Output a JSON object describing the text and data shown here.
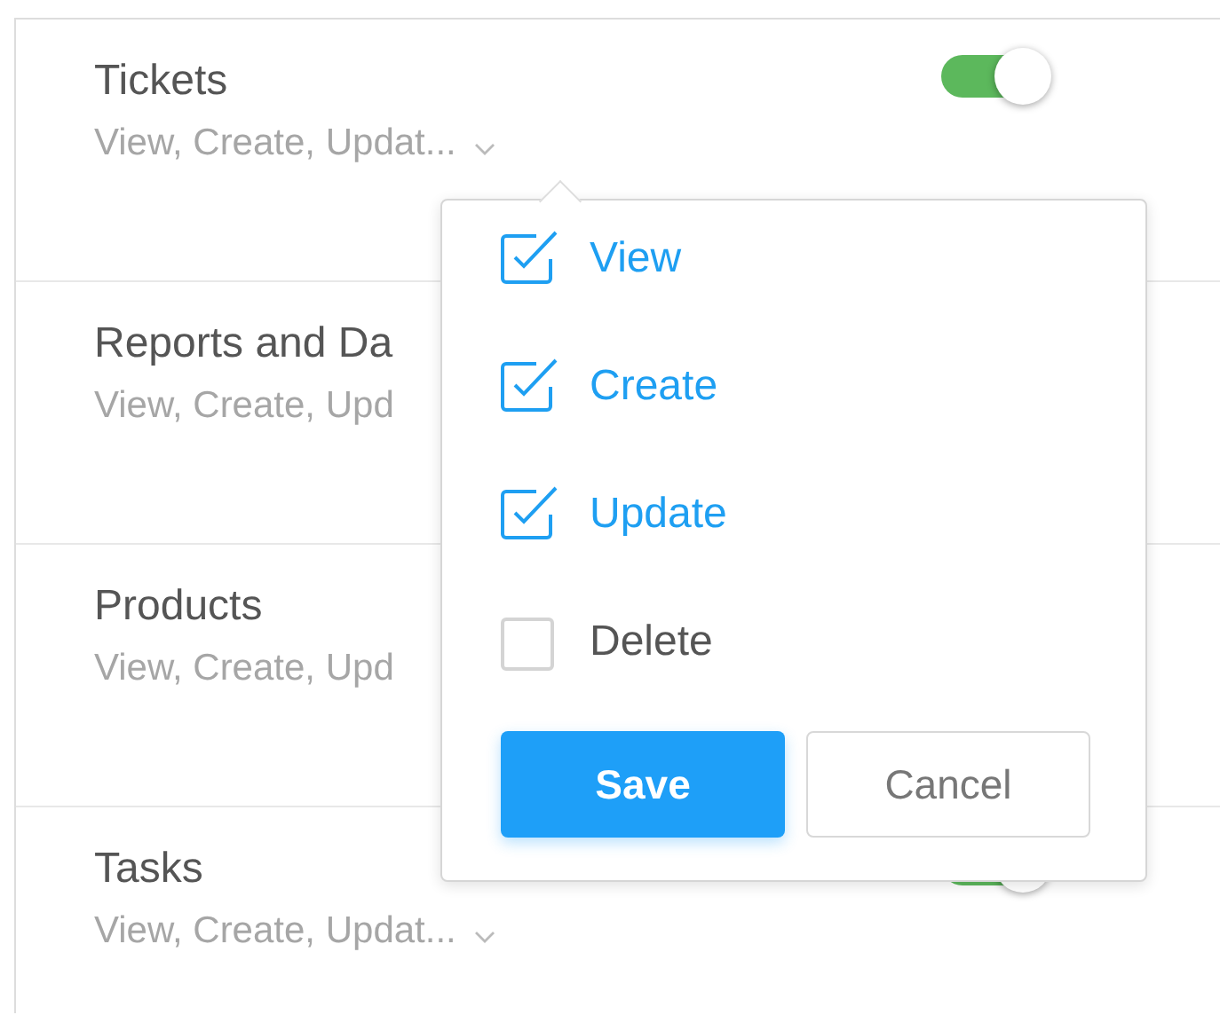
{
  "permissions": [
    {
      "name": "Tickets",
      "summary": "View, Create, Updat...",
      "chevron": true,
      "toggle": {
        "on": true
      }
    },
    {
      "name": "Reports and Da",
      "summary": "View, Create, Upd",
      "chevron": false
    },
    {
      "name": "Products",
      "summary": "View, Create, Upd",
      "chevron": false
    },
    {
      "name": "Tasks",
      "summary": "View, Create, Updat...",
      "chevron": true,
      "toggle": {
        "on": true
      }
    }
  ],
  "popover": {
    "options": [
      {
        "label": "View",
        "checked": true
      },
      {
        "label": "Create",
        "checked": true
      },
      {
        "label": "Update",
        "checked": true
      },
      {
        "label": "Delete",
        "checked": false
      }
    ],
    "buttons": [
      {
        "label": "Save",
        "kind": "primary"
      },
      {
        "label": "Cancel",
        "kind": "secondary"
      }
    ]
  }
}
